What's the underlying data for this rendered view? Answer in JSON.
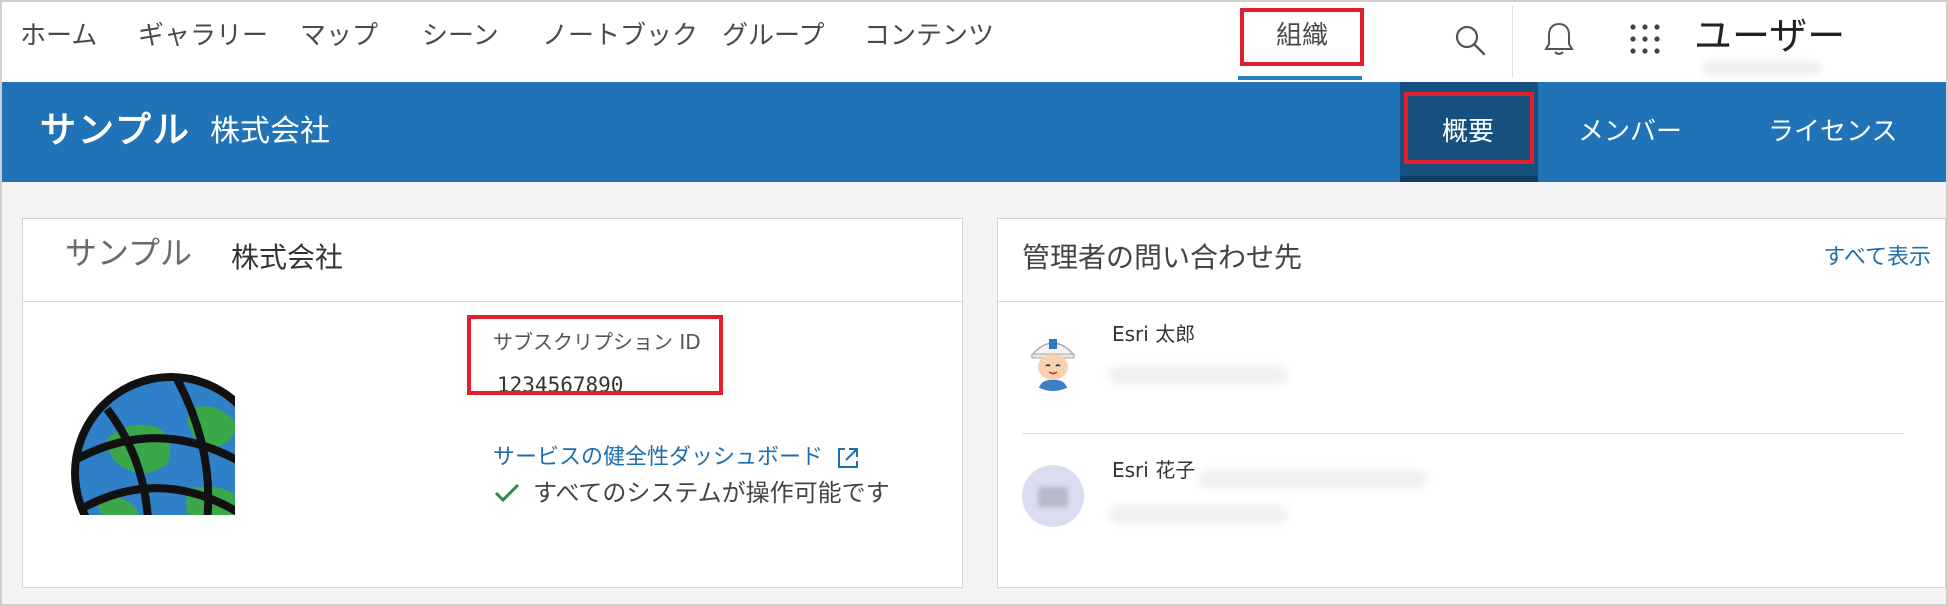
{
  "topnav": {
    "items": [
      {
        "label": "ホーム"
      },
      {
        "label": "ギャラリー"
      },
      {
        "label": "マップ"
      },
      {
        "label": "シーン"
      },
      {
        "label": "ノートブック"
      },
      {
        "label": "グループ"
      },
      {
        "label": "コンテンツ"
      },
      {
        "label": "組織",
        "active": true
      }
    ],
    "icons": [
      "search-icon",
      "bell-icon",
      "apps-grid-icon"
    ],
    "user_label": "ユーザー"
  },
  "band": {
    "org_name_primary": "サンプル",
    "org_name_secondary": "株式会社",
    "tabs": [
      {
        "label": "概要",
        "active": true
      },
      {
        "label": "メンバー"
      },
      {
        "label": "ライセンス"
      }
    ]
  },
  "org_card": {
    "title_primary": "サンプル",
    "title_secondary": "株式会社",
    "subscription_label": "サブスクリプション ID",
    "subscription_id": "1234567890",
    "health_link": "サービスの健全性ダッシュボード",
    "status": "すべてのシステムが操作可能です"
  },
  "admin_card": {
    "title": "管理者の問い合わせ先",
    "view_all": "すべて表示",
    "contacts": [
      {
        "name": "Esri 太郎"
      },
      {
        "name": "Esri 花子"
      }
    ]
  },
  "colors": {
    "accent_blue": "#1f73b6",
    "active_tab_bg": "#15507f",
    "link_blue": "#1f6fae",
    "highlight_red": "#e0202e"
  }
}
